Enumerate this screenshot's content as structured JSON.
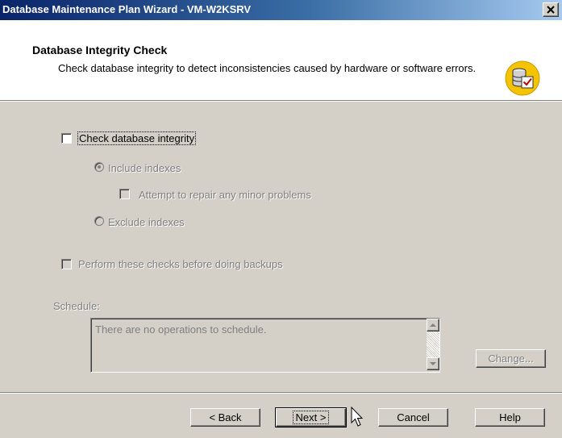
{
  "window": {
    "title": "Database Maintenance Plan Wizard - VM-W2KSRV"
  },
  "header": {
    "title": "Database Integrity Check",
    "description": "Check database integrity to detect inconsistencies caused by hardware or software errors.",
    "icon": "database-check-icon"
  },
  "options": {
    "check_integrity": {
      "label": "Check database integrity",
      "checked": false
    },
    "include_indexes": {
      "label": "Include indexes",
      "selected": true,
      "enabled": false
    },
    "repair_minor": {
      "label": "Attempt to repair any minor problems",
      "checked": false,
      "enabled": false
    },
    "exclude_indexes": {
      "label": "Exclude indexes",
      "selected": false,
      "enabled": false
    },
    "before_backups": {
      "label": "Perform these checks before doing backups",
      "checked": false,
      "enabled": false
    }
  },
  "schedule": {
    "label": "Schedule:",
    "text": "There are no operations to schedule.",
    "change_label": "Change..."
  },
  "buttons": {
    "back": "< Back",
    "next": "Next >",
    "cancel": "Cancel",
    "help": "Help"
  },
  "colors": {
    "titlebar_start": "#0a246a",
    "titlebar_end": "#a6caf0",
    "face": "#d4d0c8",
    "disabled_text": "#808080"
  }
}
